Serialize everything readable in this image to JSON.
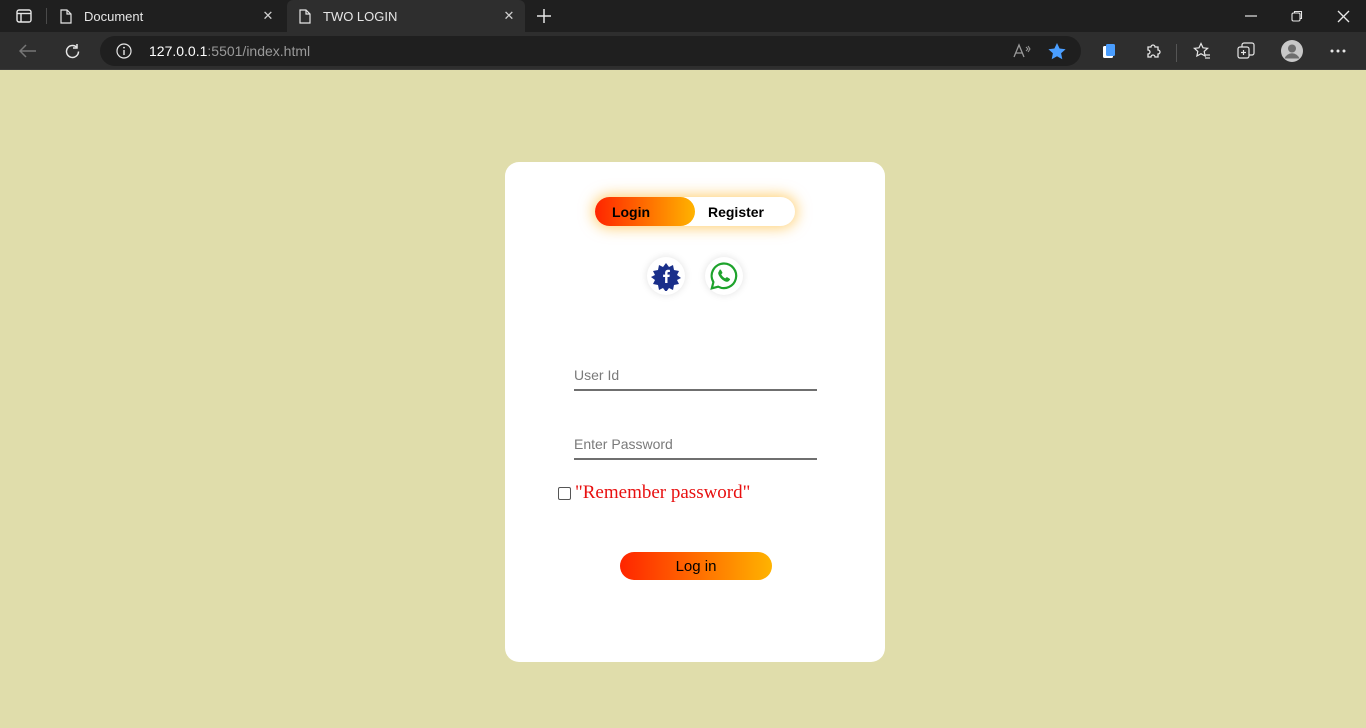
{
  "browser": {
    "tabs": [
      {
        "title": "Document",
        "active": false
      },
      {
        "title": "TWO LOGIN",
        "active": true
      }
    ],
    "address": {
      "host": "127.0.0.1",
      "rest": ":5501/index.html"
    },
    "icons": [
      "tab-actions-icon",
      "document-icon",
      "close-icon",
      "plus-icon",
      "minimize-icon",
      "restore-icon",
      "window-close-icon",
      "back-icon",
      "refresh-icon",
      "info-icon",
      "read-aloud-icon",
      "favorite-star-icon",
      "wallet-icon",
      "extensions-icon",
      "favorites-icon",
      "collections-icon",
      "profile-icon",
      "more-icon"
    ]
  },
  "page": {
    "background": "#e0ddab",
    "toggle": {
      "login_label": "Login",
      "register_label": "Register",
      "active": "login"
    },
    "social": [
      "facebook-icon",
      "whatsapp-icon"
    ],
    "form": {
      "user_placeholder": "User Id",
      "password_placeholder": "Enter Password",
      "remember_label": "\"Remember password\"",
      "remember_checked": false,
      "submit_label": "Log in"
    },
    "colors": {
      "gradient_start": "#ff2500",
      "gradient_end": "#ffb300",
      "remember_text": "#e81010"
    }
  }
}
